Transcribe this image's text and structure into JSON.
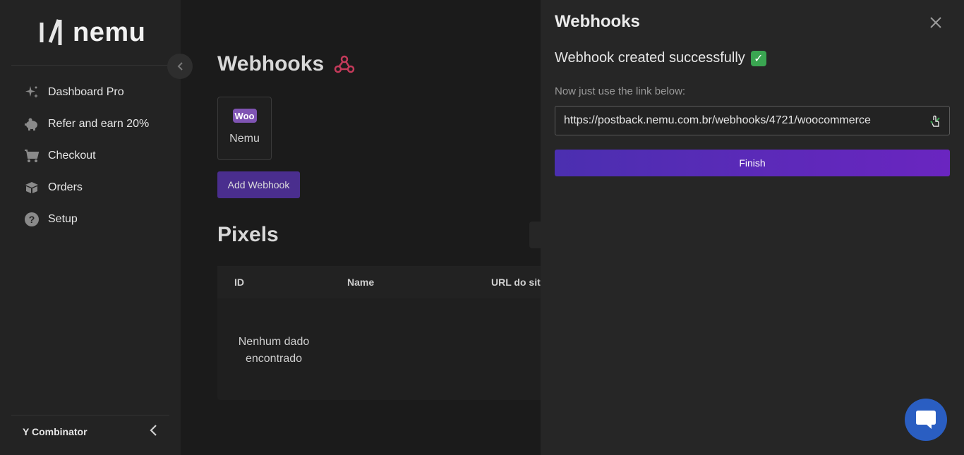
{
  "brand": {
    "name": "nemu"
  },
  "sidebar": {
    "items": [
      {
        "label": "Dashboard Pro",
        "icon": "sparkles-icon"
      },
      {
        "label": "Refer and earn 20%",
        "icon": "piggy-bank-icon"
      },
      {
        "label": "Checkout",
        "icon": "cart-icon"
      },
      {
        "label": "Orders",
        "icon": "box-icon"
      },
      {
        "label": "Setup",
        "icon": "help-circle-icon"
      }
    ],
    "org": "Y Combinator"
  },
  "main": {
    "title": "Webhooks",
    "webhook_card": {
      "badge": "Woo",
      "name": "Nemu"
    },
    "add_button": "Add Webhook",
    "pixels": {
      "title": "Pixels",
      "columns": [
        "ID",
        "Name",
        "URL do site"
      ],
      "empty": "Nenhum dado encontrado"
    }
  },
  "drawer": {
    "title": "Webhooks",
    "success": "Webhook created successfully",
    "hint": "Now just use the link below:",
    "link": "https://postback.nemu.com.br/webhooks/4721/woocommerce",
    "finish": "Finish"
  },
  "colors": {
    "accent": "#5a2bbd",
    "success": "#3aa651",
    "chat": "#2a5ec2"
  }
}
